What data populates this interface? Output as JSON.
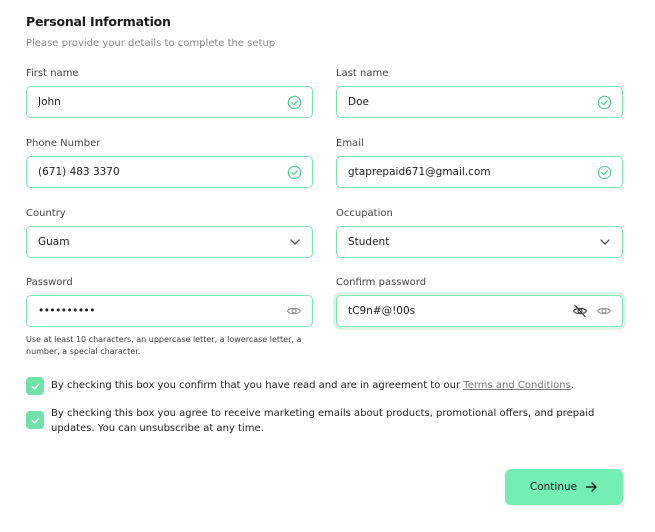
{
  "header": {
    "title": "Personal Information",
    "subtitle": "Please provide your details to complete the setup"
  },
  "form": {
    "first_name": {
      "label": "First name",
      "value": "John",
      "status": "valid"
    },
    "last_name": {
      "label": "Last name",
      "value": "Doe",
      "status": "valid"
    },
    "phone": {
      "label": "Phone Number",
      "value": "(671) 483 3370",
      "status": "valid"
    },
    "email": {
      "label": "Email",
      "value": "gtaprepaid671@gmail.com",
      "status": "valid"
    },
    "country": {
      "label": "Country",
      "value": "Guam"
    },
    "occupation": {
      "label": "Occupation",
      "value": "Student"
    },
    "password": {
      "label": "Password",
      "value": "••••••••••",
      "hint": "Use at least 10 characters, an uppercase letter, a lowercase letter, a number, a special character."
    },
    "confirm_password": {
      "label": "Confirm password",
      "value": "tC9n#@!00s"
    }
  },
  "consent": {
    "terms_prefix": "By checking this box you confirm that you have read and are in agreement to our ",
    "terms_link": "Terms and Conditions",
    "terms_suffix": ".",
    "terms_checked": true,
    "marketing_text": "By checking this box you agree to receive marketing emails about products, promotional offers, and prepaid updates. You can unsubscribe at any time.",
    "marketing_checked": true
  },
  "actions": {
    "continue_label": "Continue"
  },
  "colors": {
    "accent": "#74efb3",
    "field_border": "#7fe6b6",
    "valid_icon": "#4fcf8e"
  }
}
